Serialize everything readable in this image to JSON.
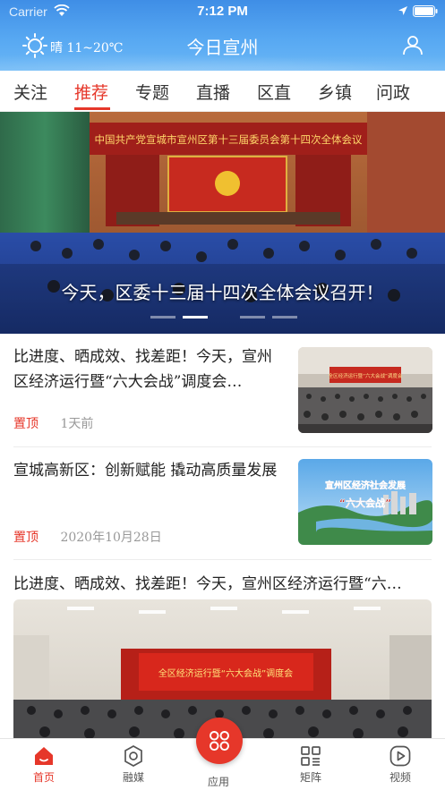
{
  "status_bar": {
    "carrier": "Carrier",
    "time": "7:12 PM"
  },
  "header": {
    "weather": "晴 11~20℃",
    "title": "今日宣州"
  },
  "tabs": [
    {
      "label": "关注",
      "active": false
    },
    {
      "label": "推荐",
      "active": true
    },
    {
      "label": "专题",
      "active": false
    },
    {
      "label": "直播",
      "active": false
    },
    {
      "label": "区直",
      "active": false
    },
    {
      "label": "乡镇",
      "active": false
    },
    {
      "label": "问政",
      "active": false
    }
  ],
  "hero": {
    "banner_text": "中国共产党宣城市宣州区第十三届委员会第十四次全体会议",
    "caption": "今天，区委十三届十四次全体会议召开！",
    "slide_count": 4,
    "active_slide": 2
  },
  "articles": [
    {
      "title": "比进度、晒成效、找差距！今天，宣州区经济运行暨“六大会战”调度会…",
      "pin": "置顶",
      "time": "1天前",
      "thumb_text": "全区经济运行暨“六大会战”调度会"
    },
    {
      "title": "宣城高新区：创新赋能 撬动高质量发展",
      "pin": "置顶",
      "time": "2020年10月28日",
      "thumb_text_1": "宣州区经济社会发展",
      "thumb_text_2": "“六大会战”"
    }
  ],
  "feature": {
    "title": "比进度、晒成效、找差距！今天，宣州区经济运行暨“六…",
    "banner_text": "全区经济运行暨“六大会战”调度会"
  },
  "bottom_nav": {
    "home": "首页",
    "media": "融媒",
    "apps": "应用",
    "matrix": "矩阵",
    "video": "视频"
  },
  "colors": {
    "accent": "#e6372a",
    "header": "#57a8f2"
  }
}
